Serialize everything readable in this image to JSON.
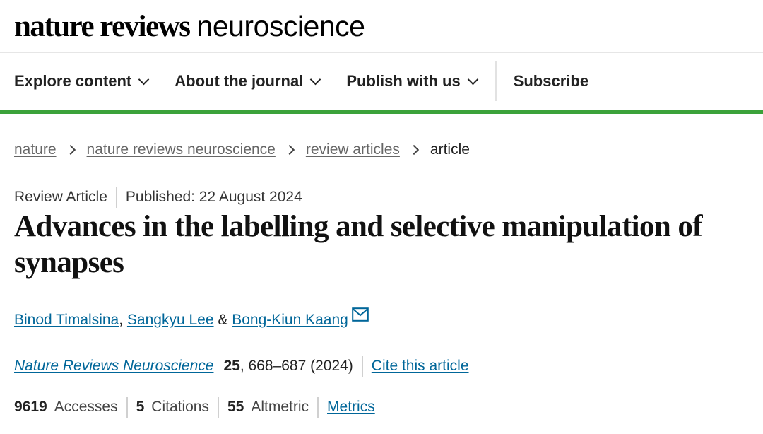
{
  "brand": {
    "bold": "nature reviews",
    "light": "neuroscience"
  },
  "nav": {
    "items": [
      {
        "label": "Explore content"
      },
      {
        "label": "About the journal"
      },
      {
        "label": "Publish with us"
      }
    ],
    "subscribe": "Subscribe"
  },
  "breadcrumb": [
    "nature",
    "nature reviews neuroscience",
    "review articles",
    "article"
  ],
  "article": {
    "type": "Review Article",
    "published": "Published: 22 August 2024",
    "title": "Advances in the labelling and selective manipulation of synapses",
    "authors": [
      "Binod Timalsina",
      "Sangkyu Lee",
      "Bong-Kiun Kaang"
    ],
    "author_sep1": ", ",
    "author_sep2": " & ",
    "journal": {
      "name": "Nature Reviews Neuroscience",
      "volume": "25",
      "pages_year": ", 668–687 (2024)",
      "cite": "Cite this article"
    },
    "metrics": {
      "accesses_value": "9619",
      "accesses_label": "Accesses",
      "citations_value": "5",
      "citations_label": "Citations",
      "altmetric_value": "55",
      "altmetric_label": "Altmetric",
      "link": "Metrics"
    }
  },
  "icons": {
    "nav_chevron": "chevron-down-icon",
    "breadcrumb_sep": "chevron-right-icon",
    "mail": "mail-icon"
  },
  "colors": {
    "accent_green": "#3ba23a",
    "link": "#006699"
  }
}
